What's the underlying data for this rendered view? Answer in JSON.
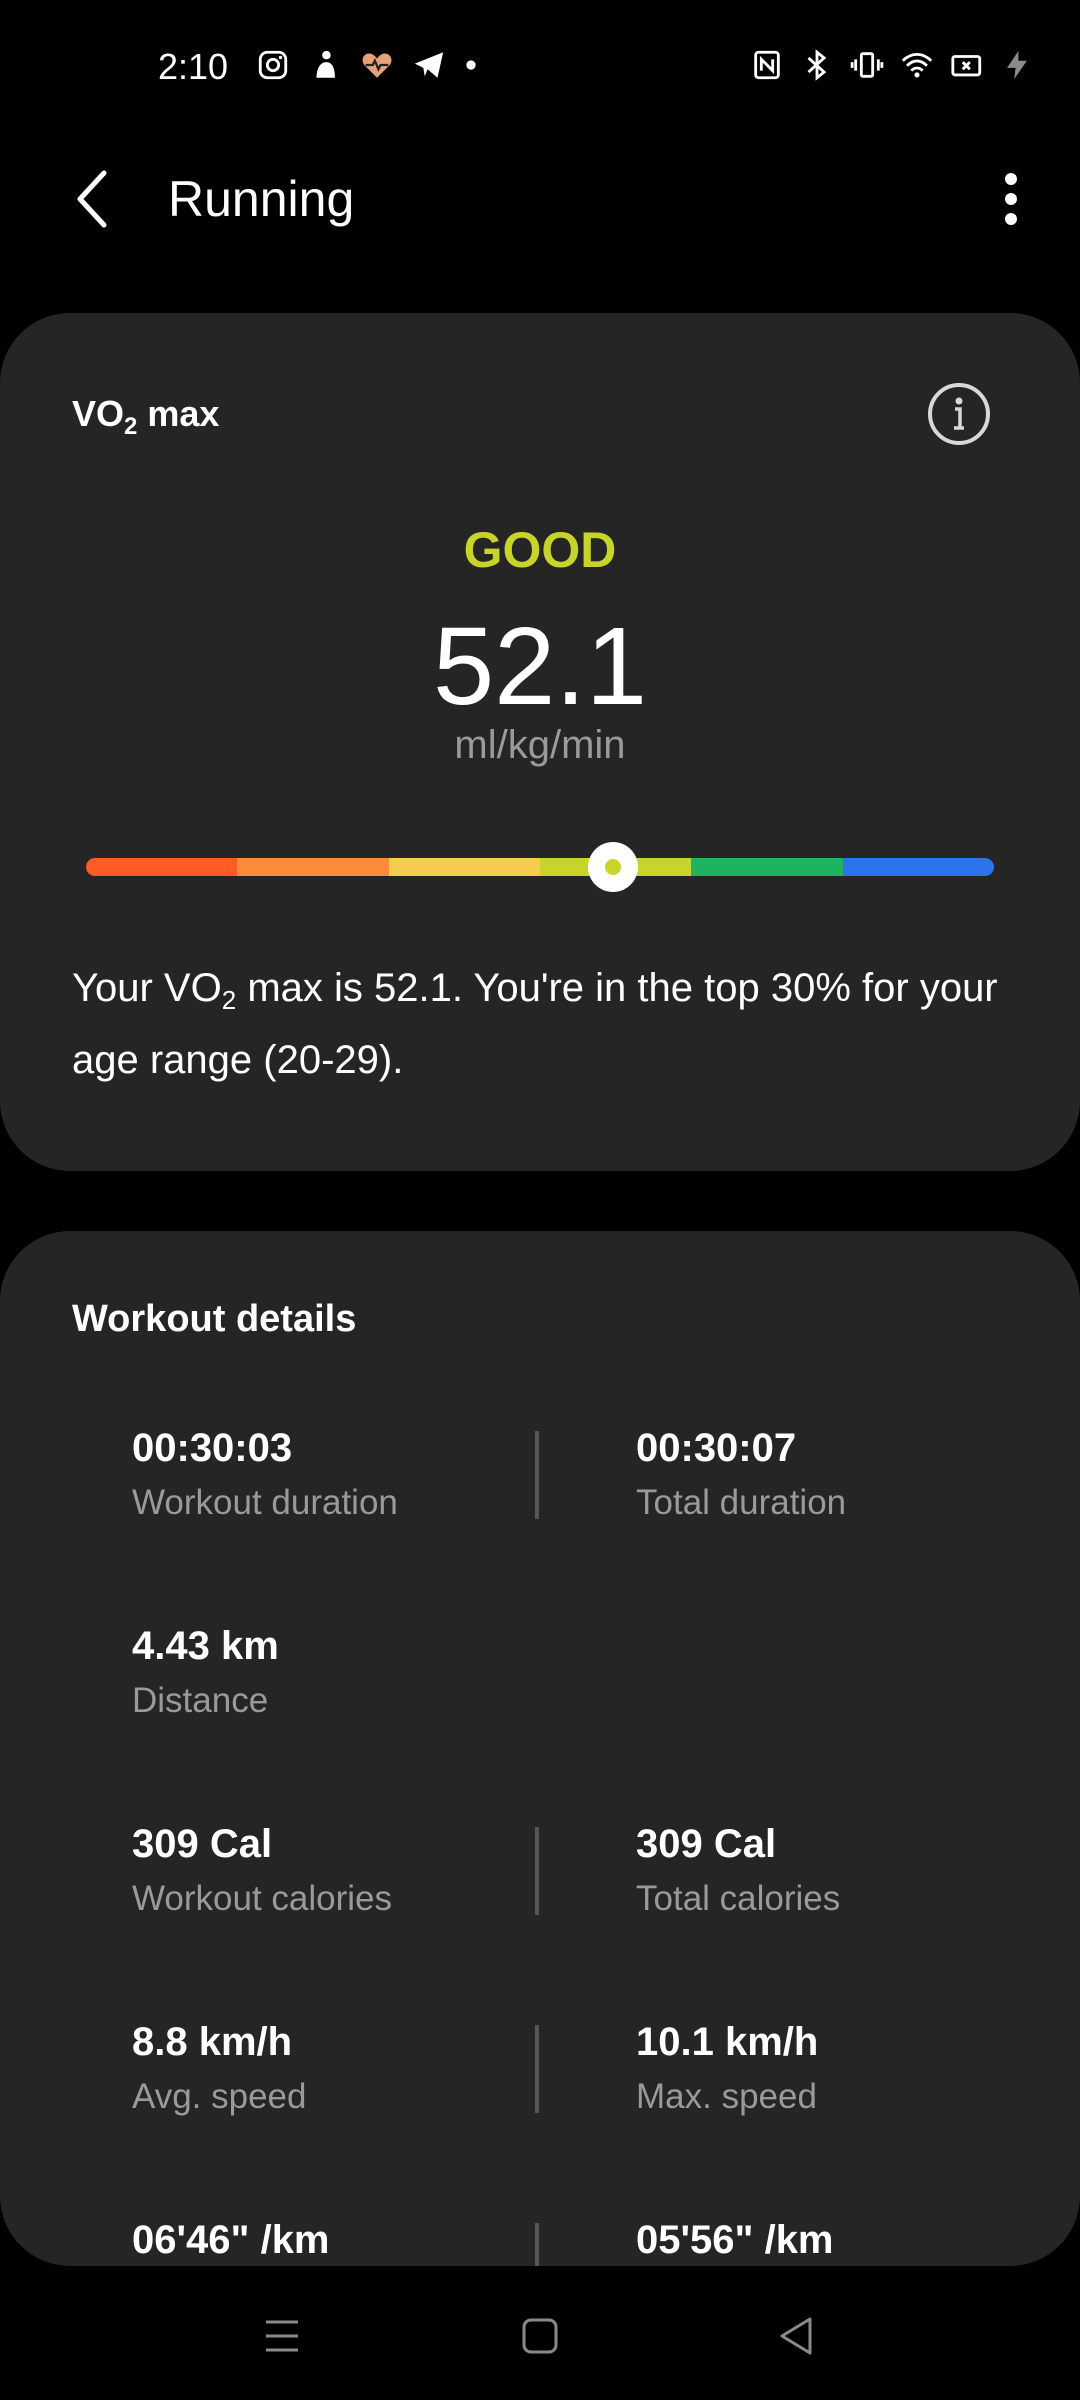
{
  "status_bar": {
    "time": "2:10",
    "left_icons": [
      "instagram-icon",
      "notification-person-icon",
      "heart-rate-icon",
      "telegram-icon",
      "dot-icon"
    ],
    "right_icons": [
      "nfc-icon",
      "bluetooth-icon",
      "vibrate-icon",
      "wifi-icon",
      "battery-saver-icon",
      "charging-icon"
    ]
  },
  "app_bar": {
    "title": "Running"
  },
  "vo2": {
    "title": "VO",
    "title_sub": "2",
    "title_rest": " max",
    "level": "GOOD",
    "value": "52.1",
    "unit": "ml/kg/min",
    "gauge_position": 0.58,
    "gauge_colors": [
      "#ff5b26",
      "#fa8c3a",
      "#f5cc4e",
      "#c8d42a",
      "#1eb35f",
      "#2c74ee"
    ],
    "level_color": "#c8d42a",
    "description_pre": "Your VO",
    "description_sub": "2",
    "description_post": " max is 52.1. You're in the top 30% for your age range (20-29)."
  },
  "workout": {
    "title": "Workout details",
    "metrics": [
      {
        "value": "00:30:03",
        "label": "Workout duration"
      },
      {
        "value": "00:30:07",
        "label": "Total duration"
      },
      {
        "value": "4.43 km",
        "label": "Distance"
      },
      {
        "value": "309 Cal",
        "label": "Workout calories"
      },
      {
        "value": "309 Cal",
        "label": "Total calories"
      },
      {
        "value": "8.8 km/h",
        "label": "Avg. speed"
      },
      {
        "value": "10.1 km/h",
        "label": "Max. speed"
      },
      {
        "value": "06'46\" /km",
        "label": ""
      },
      {
        "value": "05'56\" /km",
        "label": ""
      }
    ]
  },
  "nav_bar": {
    "items": [
      "recents-icon",
      "home-icon",
      "back-icon"
    ]
  }
}
